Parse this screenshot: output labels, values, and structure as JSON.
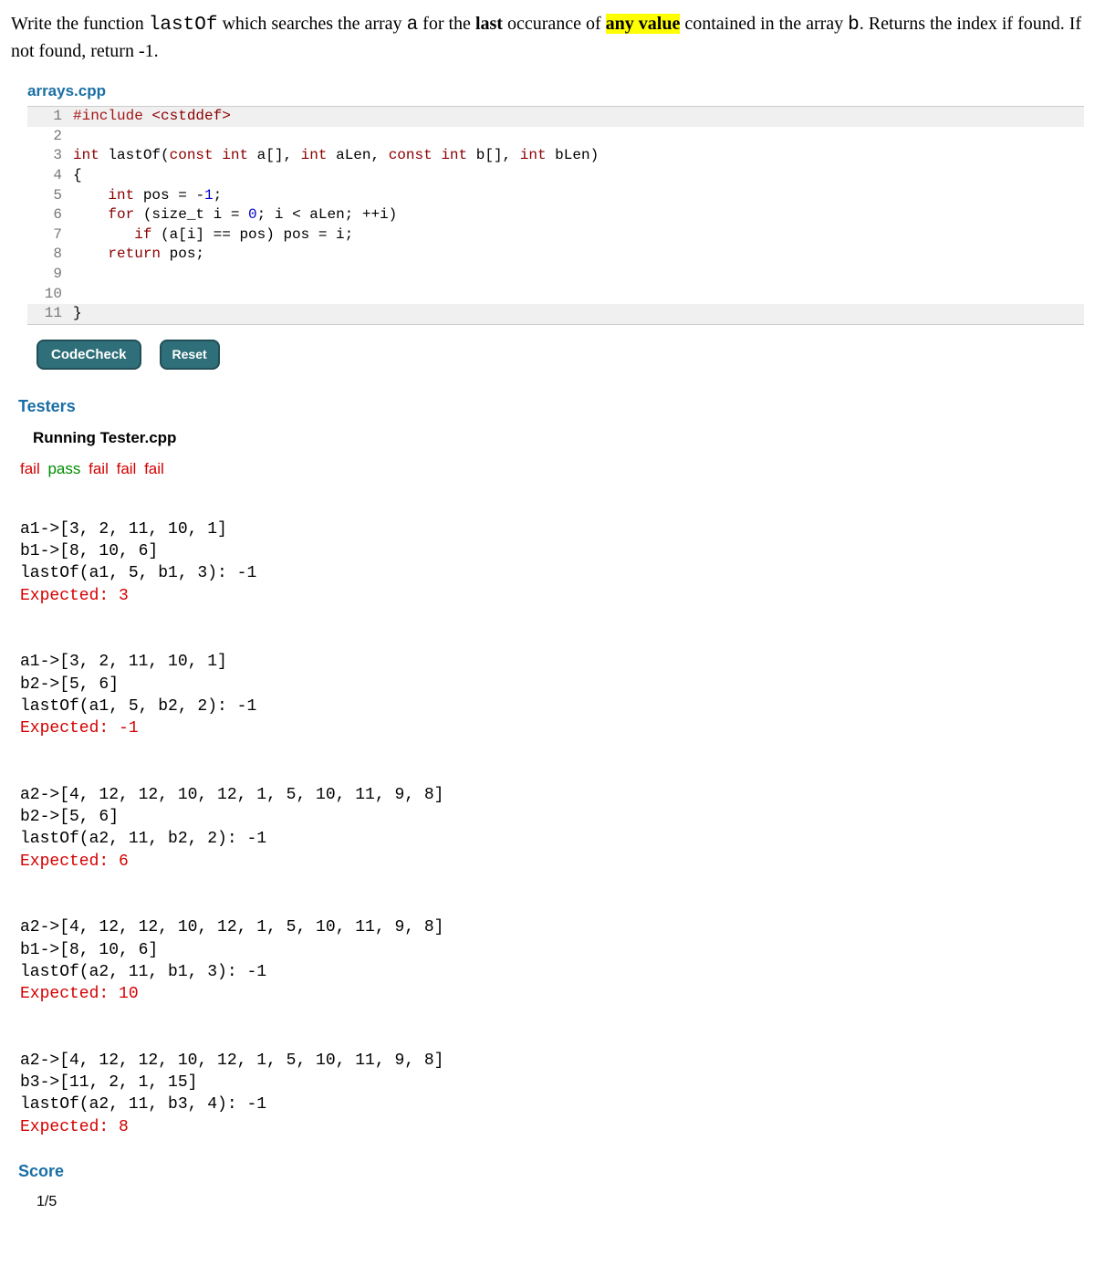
{
  "prompt": {
    "t1": "Write the function ",
    "code1": "lastOf",
    "t2": " which searches the array ",
    "code2": "a",
    "t3": " for the ",
    "bold1": "last",
    "t4": " occurance of ",
    "highlighted": "any value",
    "t5": " contained in the array ",
    "code3": "b",
    "t6": ". Returns the index if found. If not found, return -1."
  },
  "file": {
    "name": "arrays.cpp"
  },
  "code": {
    "l1": {
      "num": "1",
      "macro": "#include",
      "path": " <cstddef>"
    },
    "l2": {
      "num": "2",
      "text": ""
    },
    "l3": {
      "num": "3",
      "kw_int": "int",
      "fn": " lastOf(",
      "kw_const1": "const",
      "sp1": " ",
      "kw_int2": "int",
      "arg1": " a[], ",
      "kw_int3": "int",
      "arg2": " aLen, ",
      "kw_const2": "const",
      "sp2": " ",
      "kw_int4": "int",
      "arg3": " b[], ",
      "kw_int5": "int",
      "arg4": " bLen)"
    },
    "l4": {
      "num": "4",
      "text": "{"
    },
    "l5": {
      "num": "5",
      "indent": "    ",
      "kw_int": "int",
      "rest1": " pos = ",
      "neg": "-",
      "one": "1",
      "semi": ";"
    },
    "l6": {
      "num": "6",
      "indent": "    ",
      "kw_for": "for",
      "rest1": " (size_t i = ",
      "zero": "0",
      "rest2": "; i < aLen; ++i)"
    },
    "l7": {
      "num": "7",
      "indent": "       ",
      "kw_if": "if",
      "rest": " (a[i] == pos) pos = i;"
    },
    "l8": {
      "num": "8",
      "indent": "    ",
      "kw_return": "return",
      "rest": " pos;"
    },
    "l9": {
      "num": "9",
      "text": ""
    },
    "l10": {
      "num": "10",
      "text": ""
    },
    "l11": {
      "num": "11",
      "text": "}"
    }
  },
  "buttons": {
    "codecheck": "CodeCheck",
    "reset": "Reset"
  },
  "headings": {
    "testers": "Testers",
    "running": "Running Tester.cpp",
    "score": "Score"
  },
  "results": {
    "r1": "fail",
    "r2": "pass",
    "r3": "fail",
    "r4": "fail",
    "r5": "fail"
  },
  "tests": {
    "t1": {
      "a": "a1->[3, 2, 11, 10, 1]",
      "b": "b1->[8, 10, 6]",
      "call": "lastOf(a1, 5, b1, 3): -1",
      "expected": "Expected: 3"
    },
    "t2": {
      "a": "a1->[3, 2, 11, 10, 1]",
      "b": "b2->[5, 6]",
      "call": "lastOf(a1, 5, b2, 2): -1",
      "expected": "Expected: -1"
    },
    "t3": {
      "a": "a2->[4, 12, 12, 10, 12, 1, 5, 10, 11, 9, 8]",
      "b": "b2->[5, 6]",
      "call": "lastOf(a2, 11, b2, 2): -1",
      "expected": "Expected: 6"
    },
    "t4": {
      "a": "a2->[4, 12, 12, 10, 12, 1, 5, 10, 11, 9, 8]",
      "b": "b1->[8, 10, 6]",
      "call": "lastOf(a2, 11, b1, 3): -1",
      "expected": "Expected: 10"
    },
    "t5": {
      "a": "a2->[4, 12, 12, 10, 12, 1, 5, 10, 11, 9, 8]",
      "b": "b3->[11, 2, 1, 15]",
      "call": "lastOf(a2, 11, b3, 4): -1",
      "expected": "Expected: 8"
    }
  },
  "score": {
    "value": "1/5"
  }
}
